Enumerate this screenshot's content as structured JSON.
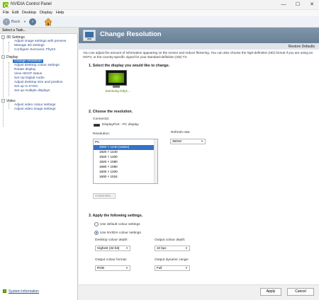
{
  "window": {
    "title": "NVIDIA Control Panel",
    "controls": [
      "—",
      "☐",
      "✕"
    ]
  },
  "menubar": [
    "File",
    "Edit",
    "Desktop",
    "Display",
    "Help"
  ],
  "toolbar": {
    "back_label": "Back"
  },
  "sidebar": {
    "header": "Select a Task...",
    "categories": [
      {
        "label": "3D Settings",
        "items": [
          "Adjust image settings with preview",
          "Manage 3D settings",
          "Configure Surround, PhysX"
        ]
      },
      {
        "label": "Display",
        "items": [
          "Change resolution",
          "Adjust desktop colour settings",
          "Rotate display",
          "View HDCP status",
          "Set Up Digital Audio",
          "Adjust desktop size and position",
          "Set up G-SYNC",
          "Set up multiple displays"
        ]
      },
      {
        "label": "Video",
        "items": [
          "Adjust video colour settings",
          "Adjust video image settings"
        ]
      }
    ],
    "selected": "Change resolution",
    "system_information": "System Information"
  },
  "main": {
    "title": "Change Resolution",
    "restore_defaults": "Restore Defaults",
    "description": "You can adjust the amount of information appearing on the screen and reduce flickering. You can also choose the high-definition (HD) format if you are using an HDTV, or the country-specific signal for your standard-definition (SD) TV.",
    "section1": "1. Select the display you would like to change.",
    "display_name": "Samsung Odys...",
    "section2": "2. Choose the resolution.",
    "connector_label": "Connector:",
    "connector_value": "DisplayPort - PC display",
    "resolution_label": "Resolution:",
    "refresh_label": "Refresh rate:",
    "refresh_value": "360Hz",
    "resolution_category": "PC",
    "resolutions": [
      "2560 × 1440 (native)",
      "1920 × 1440",
      "1920 × 1200",
      "1920 × 1080",
      "1680 × 1050",
      "1600 × 1200",
      "1600 × 1024"
    ],
    "selected_resolution": "2560 × 1440 (native)",
    "customize_label": "Customise...",
    "section3": "3. Apply the following settings.",
    "radio_default": "Use default colour settings",
    "radio_nvidia": "Use NVIDIA colour settings",
    "colour": {
      "desktop_depth_label": "Desktop colour depth:",
      "desktop_depth_value": "Highest (32-bit)",
      "output_depth_label": "Output colour depth:",
      "output_depth_value": "10 bpc",
      "output_format_label": "Output colour format:",
      "output_format_value": "RGB",
      "output_range_label": "Output dynamic range:",
      "output_range_value": "Full"
    }
  },
  "buttons": {
    "apply": "Apply",
    "cancel": "Cancel"
  },
  "colors": {
    "nvidia_green": "#76b900",
    "selection_blue": "#3272c8",
    "header_band": "#7289a0"
  }
}
